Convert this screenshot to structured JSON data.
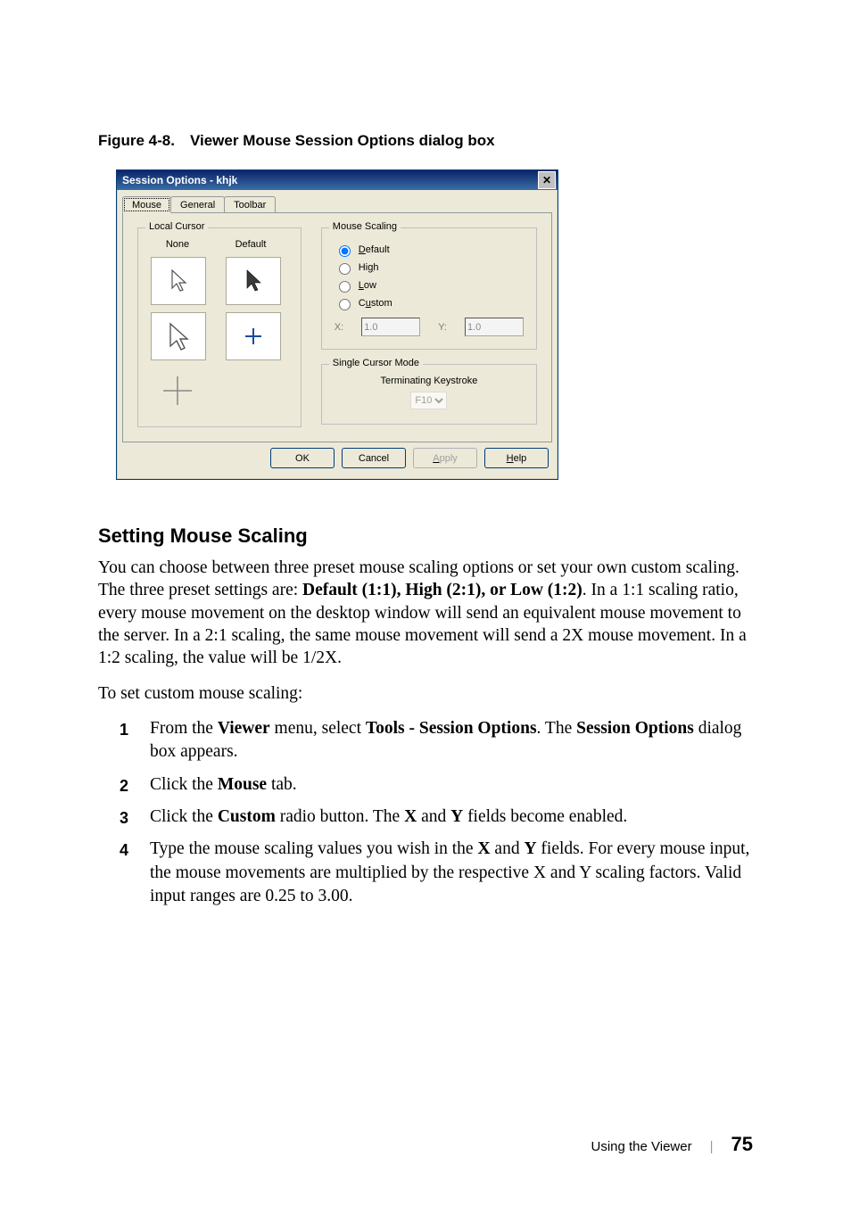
{
  "figure_caption": "Figure 4-8. Viewer Mouse Session Options dialog box",
  "dialog": {
    "title": "Session Options - khjk",
    "close_glyph": "✕",
    "tabs": {
      "mouse": "Mouse",
      "general": "General",
      "toolbar": "Toolbar"
    },
    "local_cursor": {
      "group_title": "Local Cursor",
      "col_none": "None",
      "col_default": "Default"
    },
    "mouse_scaling": {
      "group_title": "Mouse Scaling",
      "default_label": "Default",
      "default_accel": "D",
      "high_label": "High",
      "high_accel": "g",
      "low_label": "Low",
      "low_accel": "L",
      "custom_label": "Custom",
      "custom_accel": "u",
      "x_label": "X:",
      "x_value": "1.0",
      "y_label": "Y:",
      "y_value": "1.0",
      "selected": "default"
    },
    "single_cursor": {
      "group_title": "Single Cursor Mode",
      "term_label": "Terminating Keystroke",
      "term_value": "F10"
    },
    "buttons": {
      "ok": "OK",
      "cancel": "Cancel",
      "apply": "Apply",
      "apply_accel": "A",
      "help": "Help",
      "help_accel": "H"
    }
  },
  "section_heading": "Setting Mouse Scaling",
  "para1_pre": "You can choose between three preset mouse scaling options or set your own custom scaling. The three preset settings are: ",
  "para1_bold": "Default (1:1), High (2:1), or Low (1:2)",
  "para1_post": ". In a 1:1 scaling ratio, every mouse movement on the desktop window will send an equivalent mouse movement to the server. In a 2:1 scaling, the same mouse movement will send a 2X mouse movement. In a 1:2 scaling, the value will be 1/2X.",
  "para2": "To set custom mouse scaling:",
  "steps": {
    "s1_a": "From the ",
    "s1_b": "Viewer",
    "s1_c": " menu, select ",
    "s1_d": "Tools - Session Options",
    "s1_e": ". The ",
    "s1_f": "Session Options",
    "s1_g": " dialog box appears.",
    "s2_a": "Click the ",
    "s2_b": "Mouse",
    "s2_c": " tab.",
    "s3_a": "Click the ",
    "s3_b": "Custom",
    "s3_c": " radio button. The ",
    "s3_d": "X",
    "s3_e": " and ",
    "s3_f": "Y",
    "s3_g": " fields become enabled.",
    "s4_a": "Type the mouse scaling values you wish in the ",
    "s4_b": "X",
    "s4_c": " and ",
    "s4_d": "Y",
    "s4_e": " fields. For every mouse input, the mouse movements are multiplied by the respective X and Y scaling factors. Valid input ranges are 0.25 to 3.00."
  },
  "footer": {
    "section": "Using the Viewer",
    "page": "75"
  }
}
